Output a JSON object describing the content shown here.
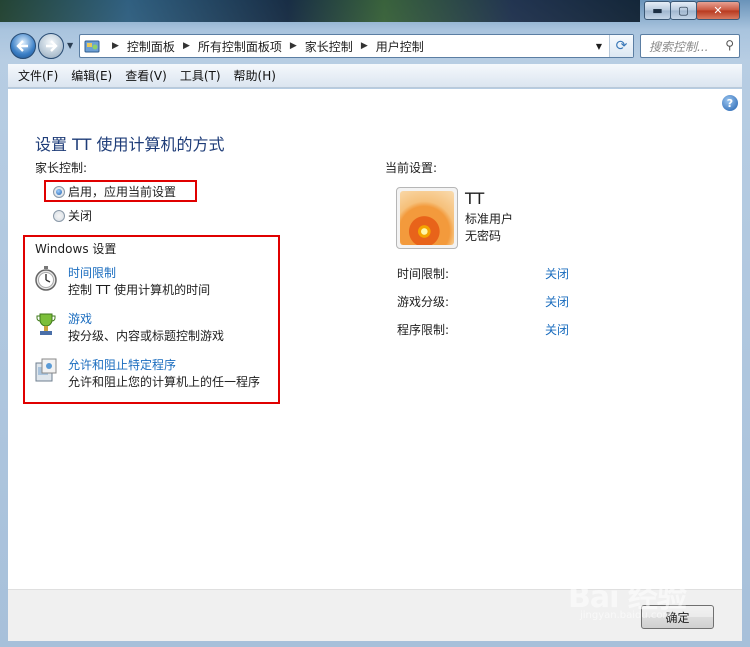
{
  "window": {
    "minimize": "▬",
    "maximize": "▢",
    "close": "✕"
  },
  "address": {
    "crumbs": [
      "控制面板",
      "所有控制面板项",
      "家长控制",
      "用户控制"
    ],
    "search_placeholder": "搜索控制..."
  },
  "menu": [
    "文件(F)",
    "编辑(E)",
    "查看(V)",
    "工具(T)",
    "帮助(H)"
  ],
  "page": {
    "title": "设置 TT 使用计算机的方式",
    "parental_label": "家长控制:",
    "radio_on": "启用，应用当前设置",
    "radio_off": "关闭",
    "radio_selected": "on",
    "windows_settings": "Windows 设置",
    "items": [
      {
        "icon": "stopwatch-icon",
        "link": "时间限制",
        "desc": "控制 TT 使用计算机的时间"
      },
      {
        "icon": "trophy-icon",
        "link": "游戏",
        "desc": "按分级、内容或标题控制游戏"
      },
      {
        "icon": "program-icon",
        "link": "允许和阻止特定程序",
        "desc": "允许和阻止您的计算机上的任一程序"
      }
    ]
  },
  "current": {
    "label": "当前设置:",
    "user_name": "TT",
    "user_type": "标准用户",
    "user_pw": "无密码",
    "rows": [
      {
        "key": "时间限制:",
        "value": "关闭"
      },
      {
        "key": "游戏分级:",
        "value": "关闭"
      },
      {
        "key": "程序限制:",
        "value": "关闭"
      }
    ]
  },
  "footer": {
    "ok": "确定"
  },
  "watermark": {
    "text": "Bai 经验",
    "sub": "jingyan.baidu.com"
  },
  "colors": {
    "link": "#1b6dbf",
    "title": "#1e3c78",
    "highlight_box": "#e00000"
  }
}
